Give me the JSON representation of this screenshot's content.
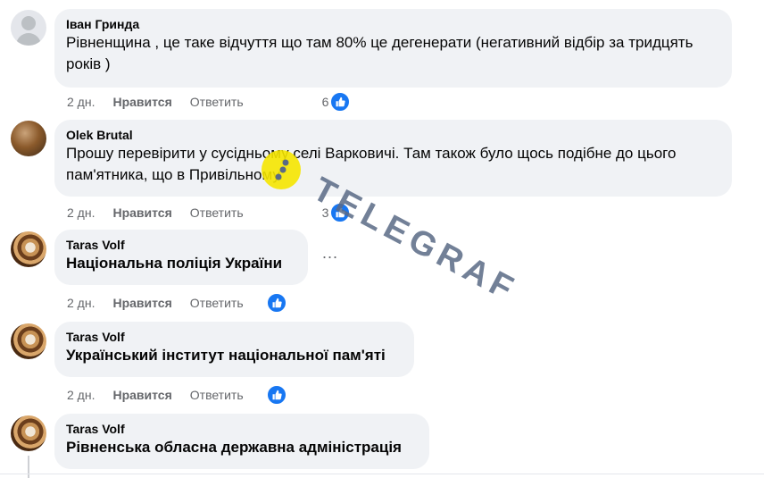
{
  "comments": [
    {
      "author": "Іван Гринда",
      "text": "Рівненщина , це таке відчуття що там 80% це дегенерати (негативний відбір за тридцять років )",
      "time": "2 дн.",
      "like_label": "Нравится",
      "reply_label": "Ответить",
      "reactions": "6"
    },
    {
      "author": "Olek Brutal",
      "text": "Прошу перевірити у сусідньому селі Варковичі. Там також було щось подібне до цього пам'ятника, що в Привільному.",
      "time": "2 дн.",
      "like_label": "Нравится",
      "reply_label": "Ответить",
      "reactions": "3"
    },
    {
      "author": "Taras Volf",
      "text": "Національна поліція України",
      "time": "2 дн.",
      "like_label": "Нравится",
      "reply_label": "Ответить",
      "reactions": "",
      "more_label": "..."
    },
    {
      "author": "Taras Volf",
      "text": "Український інститут національної пам'яті",
      "time": "2 дн.",
      "like_label": "Нравится",
      "reply_label": "Ответить",
      "reactions": ""
    },
    {
      "author": "Taras Volf",
      "text": "Рівненська обласна державна адміністрація"
    }
  ],
  "watermark": {
    "text": "TELEGRAF"
  },
  "colors": {
    "like_blue": "#1877f2",
    "bubble": "#f0f2f5",
    "muted": "#65676b",
    "watermark_yellow": "#f5e600"
  }
}
